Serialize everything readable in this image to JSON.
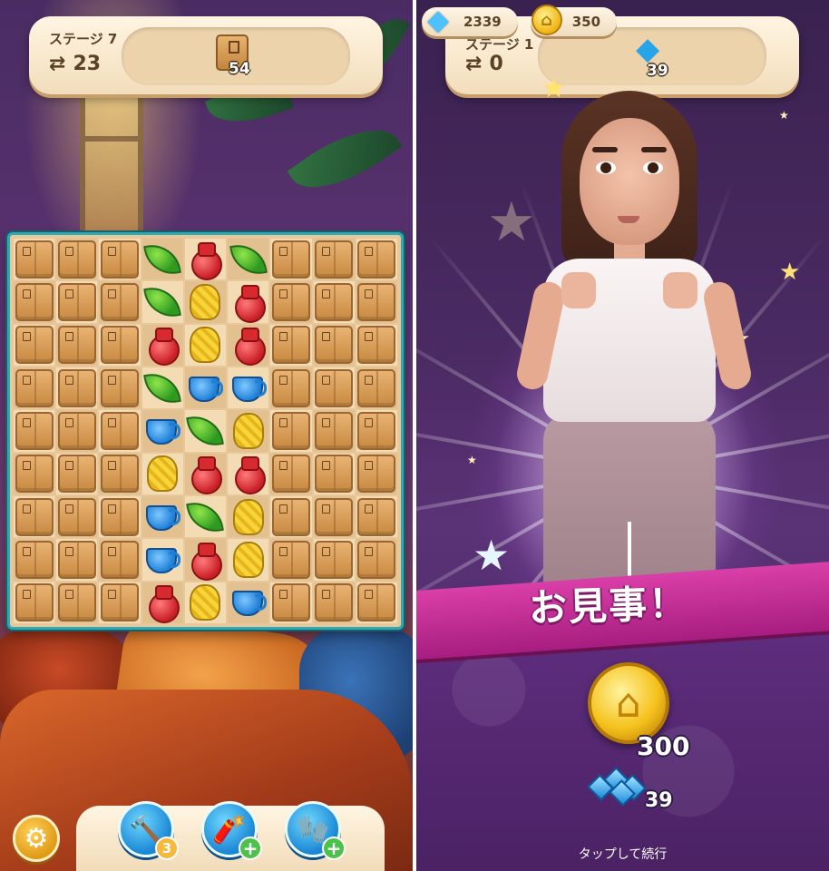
{
  "left_screen": {
    "header": {
      "stage_label": "ステージ 7",
      "moves_icon": "swap-arrows-icon",
      "moves": "23",
      "goal_icon": "crate-icon",
      "goal_count": "54"
    },
    "board": {
      "rows": 9,
      "cols": 9,
      "pieces": [
        [
          "crate",
          "crate",
          "crate",
          "leaf",
          "vase",
          "leaf",
          "crate",
          "crate",
          "crate"
        ],
        [
          "crate",
          "crate",
          "crate",
          "leaf",
          "mitten",
          "vase",
          "crate",
          "crate",
          "crate"
        ],
        [
          "crate",
          "crate",
          "crate",
          "vase",
          "mitten",
          "vase",
          "crate",
          "crate",
          "crate"
        ],
        [
          "crate",
          "crate",
          "crate",
          "leaf",
          "cup",
          "cup",
          "crate",
          "crate",
          "crate"
        ],
        [
          "crate",
          "crate",
          "crate",
          "cup",
          "leaf",
          "mitten",
          "crate",
          "crate",
          "crate"
        ],
        [
          "crate",
          "crate",
          "crate",
          "mitten",
          "vase",
          "vase",
          "crate",
          "crate",
          "crate"
        ],
        [
          "crate",
          "crate",
          "crate",
          "cup",
          "leaf",
          "mitten",
          "crate",
          "crate",
          "crate"
        ],
        [
          "crate",
          "crate",
          "crate",
          "cup",
          "vase",
          "mitten",
          "crate",
          "crate",
          "crate"
        ],
        [
          "crate",
          "crate",
          "crate",
          "vase",
          "mitten",
          "cup",
          "crate",
          "crate",
          "crate"
        ]
      ]
    },
    "footer": {
      "settings_icon": "gear-icon",
      "boosters": [
        {
          "name": "hammer-icon",
          "badge": "3"
        },
        {
          "name": "firework-roll-icon",
          "badge": "+"
        },
        {
          "name": "glove-icon",
          "badge": "+"
        }
      ]
    }
  },
  "right_screen": {
    "currency": {
      "gems": "2339",
      "coins": "350",
      "gem_icon": "diamond-icon",
      "coin_icon": "house-coin-icon"
    },
    "header": {
      "stage_label": "ステージ 1",
      "moves": "0",
      "goal_icon": "diamond-icon",
      "goal_count": "39"
    },
    "banner": {
      "title": "お見事！"
    },
    "rewards": {
      "coin_amount": "300",
      "gem_amount": "39"
    },
    "tap_to_continue": "タップして続行"
  },
  "colors": {
    "board_border": "#2fa9b3",
    "ribbon": "#c5319a",
    "panel_cream": "#fff5e2",
    "coin_gold": "#f5c21c",
    "gem_blue": "#1a8ad8"
  }
}
